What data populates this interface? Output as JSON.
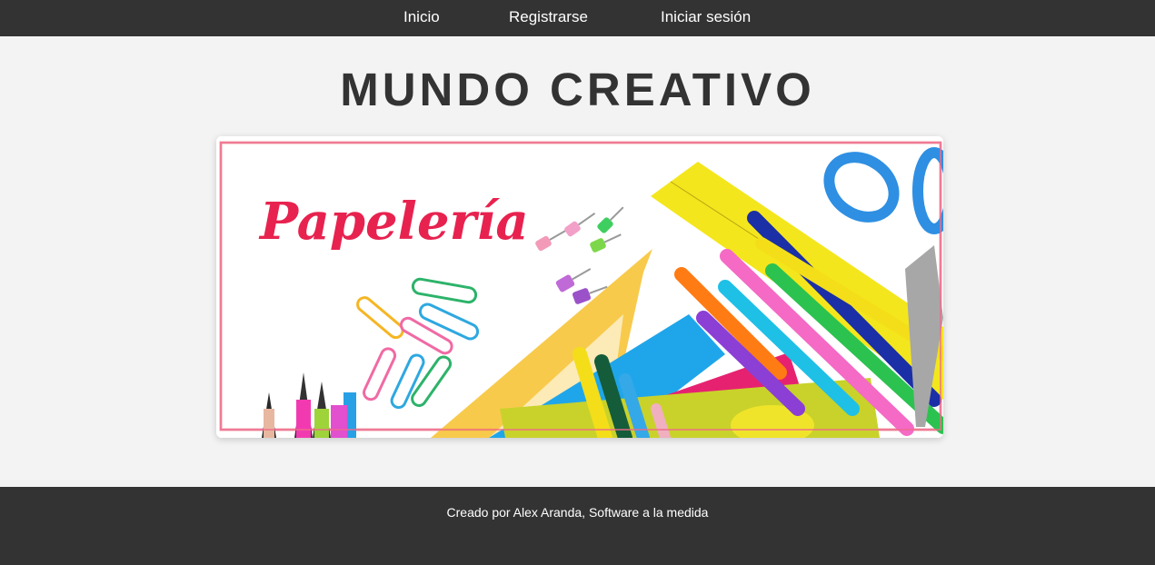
{
  "nav": {
    "items": [
      {
        "label": "Inicio"
      },
      {
        "label": "Registrarse"
      },
      {
        "label": "Iniciar sesión"
      }
    ]
  },
  "header": {
    "title": "MUNDO CREATIVO"
  },
  "banner": {
    "script_text": "Papelería",
    "accent_color": "#e8224f"
  },
  "footer": {
    "credit": "Creado por Alex Aranda, Software a la medida"
  },
  "colors": {
    "nav_bg": "#333333",
    "page_bg": "#f3f3f3",
    "title": "#333333"
  }
}
